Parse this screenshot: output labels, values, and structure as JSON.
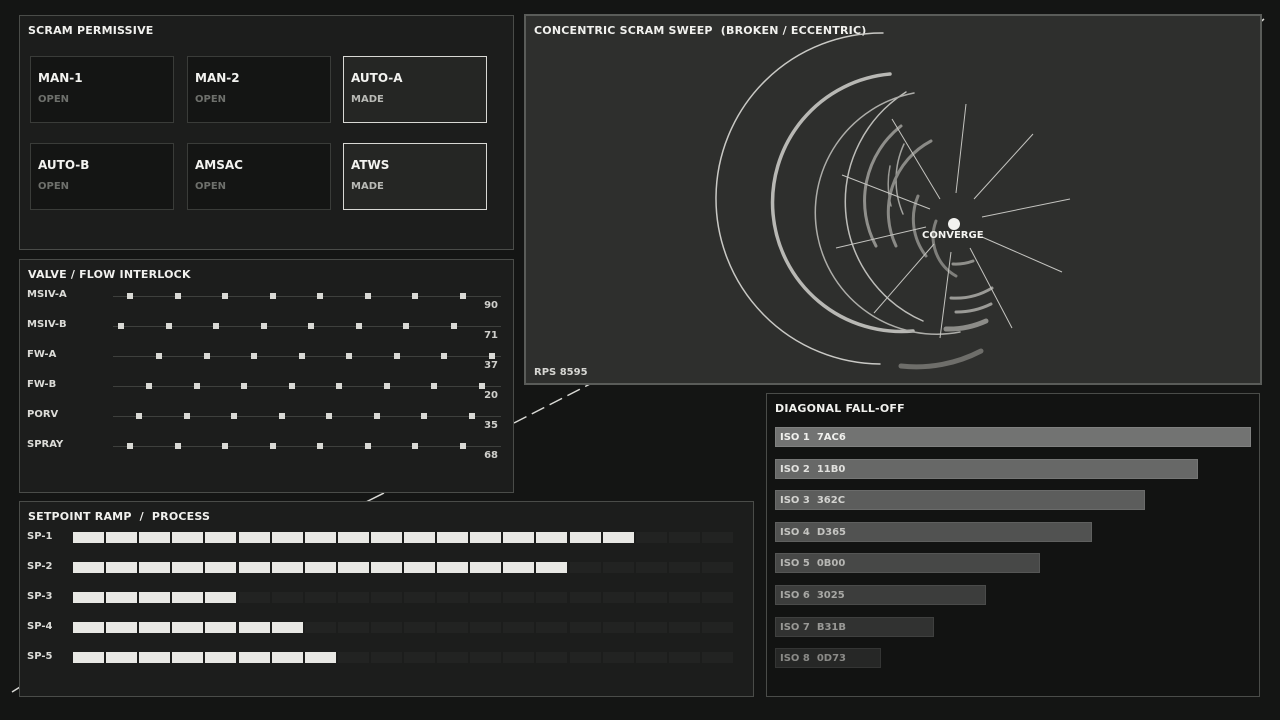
{
  "scram": {
    "title": "SCRAM PERMISSIVE",
    "tiles": [
      {
        "name": "MAN-1",
        "state": "OPEN",
        "made": false
      },
      {
        "name": "MAN-2",
        "state": "OPEN",
        "made": false
      },
      {
        "name": "AUTO-A",
        "state": "MADE",
        "made": true
      },
      {
        "name": "AUTO-B",
        "state": "OPEN",
        "made": false
      },
      {
        "name": "AMSAC",
        "state": "OPEN",
        "made": false
      },
      {
        "name": "ATWS",
        "state": "MADE",
        "made": true
      }
    ]
  },
  "valve": {
    "title": "VALVE / FLOW INTERLOCK",
    "rows": [
      {
        "label": "MSIV-A",
        "value": "90"
      },
      {
        "label": "MSIV-B",
        "value": "71"
      },
      {
        "label": "FW-A",
        "value": "37"
      },
      {
        "label": "FW-B",
        "value": "20"
      },
      {
        "label": "PORV",
        "value": "35"
      },
      {
        "label": "SPRAY",
        "value": "68"
      }
    ]
  },
  "setpoint": {
    "title": "SETPOINT RAMP  /  PROCESS",
    "total_segments": 20,
    "rows": [
      {
        "label": "SP-1",
        "lit": 17
      },
      {
        "label": "SP-2",
        "lit": 15
      },
      {
        "label": "SP-3",
        "lit": 5
      },
      {
        "label": "SP-4",
        "lit": 7
      },
      {
        "label": "SP-5",
        "lit": 8
      }
    ]
  },
  "sweep": {
    "title": "CONCENTRIC SCRAM SWEEP  (BROKEN / ECCENTRIC)",
    "center_label": "CONVERGE",
    "footer": "RPS 8595"
  },
  "falloff": {
    "title": "DIAGONAL FALL-OFF",
    "bars": [
      {
        "label": "ISO 1  7AC6",
        "fraction": 1.0
      },
      {
        "label": "ISO 2  11B0",
        "fraction": 0.889
      },
      {
        "label": "ISO 3  362C",
        "fraction": 0.778
      },
      {
        "label": "ISO 4  D365",
        "fraction": 0.667
      },
      {
        "label": "ISO 5  0B00",
        "fraction": 0.556
      },
      {
        "label": "ISO 6  3025",
        "fraction": 0.444
      },
      {
        "label": "ISO 7  B31B",
        "fraction": 0.333
      },
      {
        "label": "ISO 8  0D73",
        "fraction": 0.222
      }
    ]
  }
}
